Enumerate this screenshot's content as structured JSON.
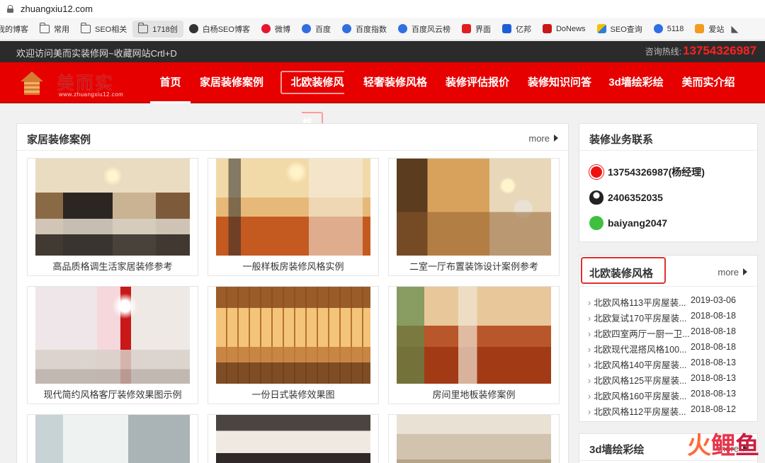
{
  "browser": {
    "url": "zhuangxiu12.com",
    "bookmarks": [
      {
        "label": "我的博客",
        "icon": "folder-icon"
      },
      {
        "label": "常用",
        "icon": "folder-icon"
      },
      {
        "label": "SEO相关",
        "icon": "folder-icon"
      },
      {
        "label": "1718创",
        "icon": "folder-icon"
      },
      {
        "label": "白杨SEO博客",
        "icon": "globe-icon"
      },
      {
        "label": "微博",
        "icon": "weibo-icon"
      },
      {
        "label": "百度",
        "icon": "baidu-paw-icon"
      },
      {
        "label": "百度指数",
        "icon": "baidu-paw-icon"
      },
      {
        "label": "百度风云榜",
        "icon": "baidu-paw-icon"
      },
      {
        "label": "界面",
        "icon": "jiemian-icon"
      },
      {
        "label": "亿邦",
        "icon": "yibang-icon"
      },
      {
        "label": "DoNews",
        "icon": "donews-icon"
      },
      {
        "label": "SEO查询",
        "icon": "seo-query-icon"
      },
      {
        "label": "5118",
        "icon": "5118-icon"
      },
      {
        "label": "爱站",
        "icon": "aizhan-icon"
      }
    ]
  },
  "topbar": {
    "welcome": "欢迎访问美而实装修网~收藏网站Crtl+D",
    "hotline_label": "咨询热线:",
    "hotline_number": "13754326987"
  },
  "logo": {
    "name": "美而实",
    "url": "www.zhuangxiu12.com"
  },
  "nav": {
    "items": [
      "首页",
      "家居装修案例",
      "北欧装修风格",
      "轻奢装修风格",
      "装修评估报价",
      "装修知识问答",
      "3d墙绘彩绘",
      "美而实介绍"
    ]
  },
  "cases": {
    "title": "家居装修案例",
    "more": "more",
    "items": [
      "高品质格调生活家居装修参考",
      "一般样板房装修风格实例",
      "二室一厅布置装饰设计案例参考",
      "现代简约风格客厅装修效果图示例",
      "一份日式装修效果图",
      "房间里地板装修案例"
    ]
  },
  "contact": {
    "title": "装修业务联系",
    "phone": "13754326987(杨经理)",
    "qq": "2406352035",
    "wechat": "baiyang2047"
  },
  "nordic": {
    "title": "北欧装修风格",
    "more": "more",
    "items": [
      {
        "title": "北欧风格113平房屋装...",
        "date": "2019-03-06"
      },
      {
        "title": "北欧复试170平房屋装...",
        "date": "2018-08-18"
      },
      {
        "title": "北欧四室两厅一厨一卫...",
        "date": "2018-08-18"
      },
      {
        "title": "北欧现代混搭风格100...",
        "date": "2018-08-18"
      },
      {
        "title": "北欧风格140平房屋装...",
        "date": "2018-08-13"
      },
      {
        "title": "北欧风格125平房屋装...",
        "date": "2018-08-13"
      },
      {
        "title": "北欧风格160平房屋装...",
        "date": "2018-08-13"
      },
      {
        "title": "北欧风格112平房屋装...",
        "date": "2018-08-12"
      }
    ]
  },
  "mural": {
    "title": "3d墙绘彩绘",
    "more": "more"
  },
  "watermark": {
    "text": "火鲤鱼"
  }
}
